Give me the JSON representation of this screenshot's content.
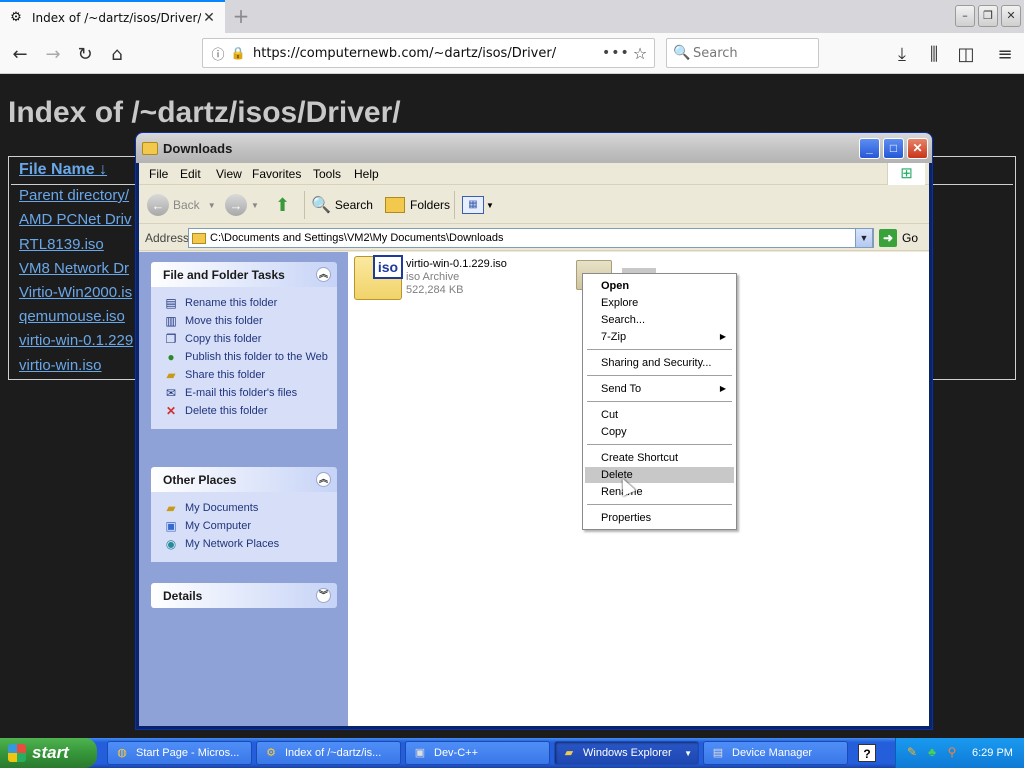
{
  "browser": {
    "tab_title": "Index of /~dartz/isos/Driver/",
    "url": "https://computernewb.com/~dartz/isos/Driver/",
    "search_placeholder": "Search"
  },
  "page": {
    "heading": "Index of /~dartz/isos/Driver/",
    "column_header": "File Name ↓",
    "links": [
      "Parent directory/",
      "AMD PCNet Driv",
      "RTL8139.iso",
      "VM8 Network Dr",
      "Virtio-Win2000.is",
      "qemumouse.iso",
      "virtio-win-0.1.229",
      "virtio-win.iso"
    ]
  },
  "explorer": {
    "title": "Downloads",
    "menu": [
      "File",
      "Edit",
      "View",
      "Favorites",
      "Tools",
      "Help"
    ],
    "toolbar": {
      "back": "Back",
      "search": "Search",
      "folders": "Folders"
    },
    "address_label": "Address",
    "address_value": "C:\\Documents and Settings\\VM2\\My Documents\\Downloads",
    "go_label": "Go",
    "tasks_panel": {
      "title": "File and Folder Tasks",
      "items": [
        "Rename this folder",
        "Move this folder",
        "Copy this folder",
        "Publish this folder to the Web",
        "Share this folder",
        "E-mail this folder's files",
        "Delete this folder"
      ]
    },
    "places_panel": {
      "title": "Other Places",
      "items": [
        "My Documents",
        "My Computer",
        "My Network Places"
      ]
    },
    "details_panel": {
      "title": "Details"
    },
    "file": {
      "name": "virtio-win-0.1.229.iso",
      "type": "iso Archive",
      "size": "522,284 KB",
      "badge": "iso"
    }
  },
  "context_menu": {
    "items": [
      {
        "label": "Open",
        "bold": true
      },
      {
        "label": "Explore"
      },
      {
        "label": "Search..."
      },
      {
        "label": "7-Zip",
        "submenu": true
      },
      {
        "label": "Sharing and Security..."
      },
      {
        "label": "Send To",
        "submenu": true
      },
      {
        "label": "Cut"
      },
      {
        "label": "Copy"
      },
      {
        "label": "Create Shortcut"
      },
      {
        "label": "Delete",
        "highlighted": true
      },
      {
        "label": "Rename"
      },
      {
        "label": "Properties"
      }
    ]
  },
  "taskbar": {
    "start_label": "start",
    "tasks": [
      "Start Page - Micros...",
      "Index of /~dartz/is...",
      "Dev-C++",
      "Windows Explorer",
      "Device Manager"
    ],
    "clock": "6:29 PM"
  }
}
